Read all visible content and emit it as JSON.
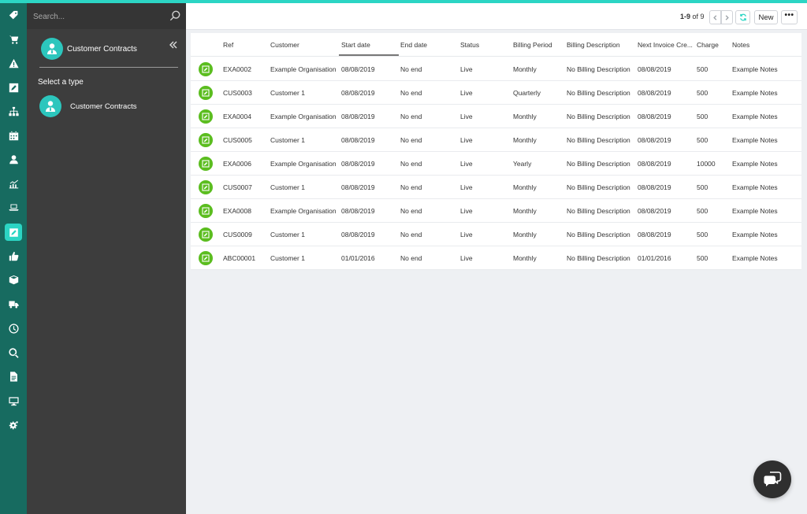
{
  "rail": {
    "items": [
      {
        "icon": "tag-icon",
        "active": false
      },
      {
        "icon": "cart-icon",
        "active": false
      },
      {
        "icon": "warning-icon",
        "active": false
      },
      {
        "icon": "edit-icon",
        "active": false
      },
      {
        "icon": "hierarchy-icon",
        "active": false
      },
      {
        "icon": "calendar-icon",
        "active": false
      },
      {
        "icon": "user-icon",
        "active": false
      },
      {
        "icon": "chart-icon",
        "active": false
      },
      {
        "icon": "laptop-icon",
        "active": false
      },
      {
        "icon": "contract-icon",
        "active": true
      },
      {
        "icon": "thumbs-up-icon",
        "active": false
      },
      {
        "icon": "box-icon",
        "active": false
      },
      {
        "icon": "truck-icon",
        "active": false
      },
      {
        "icon": "clock-icon",
        "active": false
      },
      {
        "icon": "search-icon",
        "active": false
      },
      {
        "icon": "document-icon",
        "active": false
      },
      {
        "icon": "monitor-icon",
        "active": false
      },
      {
        "icon": "settings-icon",
        "active": false
      }
    ]
  },
  "panel": {
    "search_placeholder": "Search...",
    "current_type_label": "Customer Contracts",
    "select_heading": "Select a type",
    "type_options": [
      {
        "label": "Customer Contracts"
      }
    ]
  },
  "toolbar": {
    "pager_range": "1-9",
    "pager_of": " of ",
    "pager_total": "9",
    "new_label": "New",
    "more_label": "•••"
  },
  "table": {
    "columns": [
      "Ref",
      "Customer",
      "Start date",
      "End date",
      "Status",
      "Billing Period",
      "Billing Description",
      "Next Invoice Cre...",
      "Charge",
      "Notes"
    ],
    "rows": [
      [
        "EXA0002",
        "Example Organisation",
        "08/08/2019",
        "No end",
        "Live",
        "Monthly",
        "No Billing Description",
        "08/08/2019",
        "500",
        "Example Notes"
      ],
      [
        "CUS0003",
        "Customer 1",
        "08/08/2019",
        "No end",
        "Live",
        "Quarterly",
        "No Billing Description",
        "08/08/2019",
        "500",
        "Example Notes"
      ],
      [
        "EXA0004",
        "Example Organisation",
        "08/08/2019",
        "No end",
        "Live",
        "Monthly",
        "No Billing Description",
        "08/08/2019",
        "500",
        "Example Notes"
      ],
      [
        "CUS0005",
        "Customer 1",
        "08/08/2019",
        "No end",
        "Live",
        "Monthly",
        "No Billing Description",
        "08/08/2019",
        "500",
        "Example Notes"
      ],
      [
        "EXA0006",
        "Example Organisation",
        "08/08/2019",
        "No end",
        "Live",
        "Yearly",
        "No Billing Description",
        "08/08/2019",
        "10000",
        "Example Notes"
      ],
      [
        "CUS0007",
        "Customer 1",
        "08/08/2019",
        "No end",
        "Live",
        "Monthly",
        "No Billing Description",
        "08/08/2019",
        "500",
        "Example Notes"
      ],
      [
        "EXA0008",
        "Example Organisation",
        "08/08/2019",
        "No end",
        "Live",
        "Monthly",
        "No Billing Description",
        "08/08/2019",
        "500",
        "Example Notes"
      ],
      [
        "CUS0009",
        "Customer 1",
        "08/08/2019",
        "No end",
        "Live",
        "Monthly",
        "No Billing Description",
        "08/08/2019",
        "500",
        "Example Notes"
      ],
      [
        "ABC00001",
        "Customer 1",
        "01/01/2016",
        "No end",
        "Live",
        "Monthly",
        "No Billing Description",
        "01/01/2016",
        "500",
        "Example Notes"
      ]
    ]
  },
  "colors": {
    "accent": "#2cd5c4",
    "rail": "#176b60",
    "panel": "#3d3d3d",
    "row_icon": "#5bbd1f"
  },
  "chat": {
    "icon": "chat-icon"
  }
}
